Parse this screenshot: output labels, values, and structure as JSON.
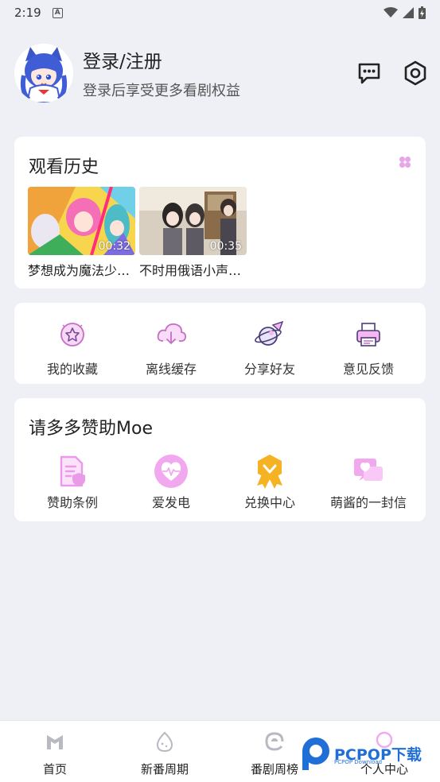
{
  "status_bar": {
    "time": "2:19",
    "badge": "A"
  },
  "profile": {
    "title": "登录/注册",
    "subtitle": "登录后享受更多看剧权益"
  },
  "header_icons": [
    "chat-icon",
    "settings-icon"
  ],
  "history": {
    "title": "观看历史",
    "items": [
      {
        "title": "梦想成为魔法少…",
        "duration": "00:32"
      },
      {
        "title": "不时用俄语小声…",
        "duration": "00:35"
      }
    ]
  },
  "tools": [
    {
      "label": "我的收藏",
      "icon": "star-badge-icon"
    },
    {
      "label": "离线缓存",
      "icon": "cloud-download-icon"
    },
    {
      "label": "分享好友",
      "icon": "share-planet-icon"
    },
    {
      "label": "意见反馈",
      "icon": "printer-feedback-icon"
    }
  ],
  "sponsor": {
    "title": "请多多赞助Moe",
    "items": [
      {
        "label": "赞助条例",
        "icon": "document-shield-icon"
      },
      {
        "label": "爱发电",
        "icon": "heart-pulse-icon"
      },
      {
        "label": "兑换中心",
        "icon": "medal-icon"
      },
      {
        "label": "萌酱的一封信",
        "icon": "letter-heart-icon"
      }
    ]
  },
  "tabs": [
    {
      "label": "首页",
      "icon": "home-m-icon"
    },
    {
      "label": "新番周期",
      "icon": "egg-icon"
    },
    {
      "label": "番剧周榜",
      "icon": "swirl-e-icon"
    },
    {
      "label": "个人中心",
      "icon": "person-icon"
    }
  ],
  "colors": {
    "accent": "#e6a6e8",
    "accent_strong": "#d86fd8",
    "medal": "#f5b324",
    "background": "#eef0f6"
  },
  "watermark": {
    "text": "PCPOP下载",
    "small": "PCPOP Download"
  }
}
